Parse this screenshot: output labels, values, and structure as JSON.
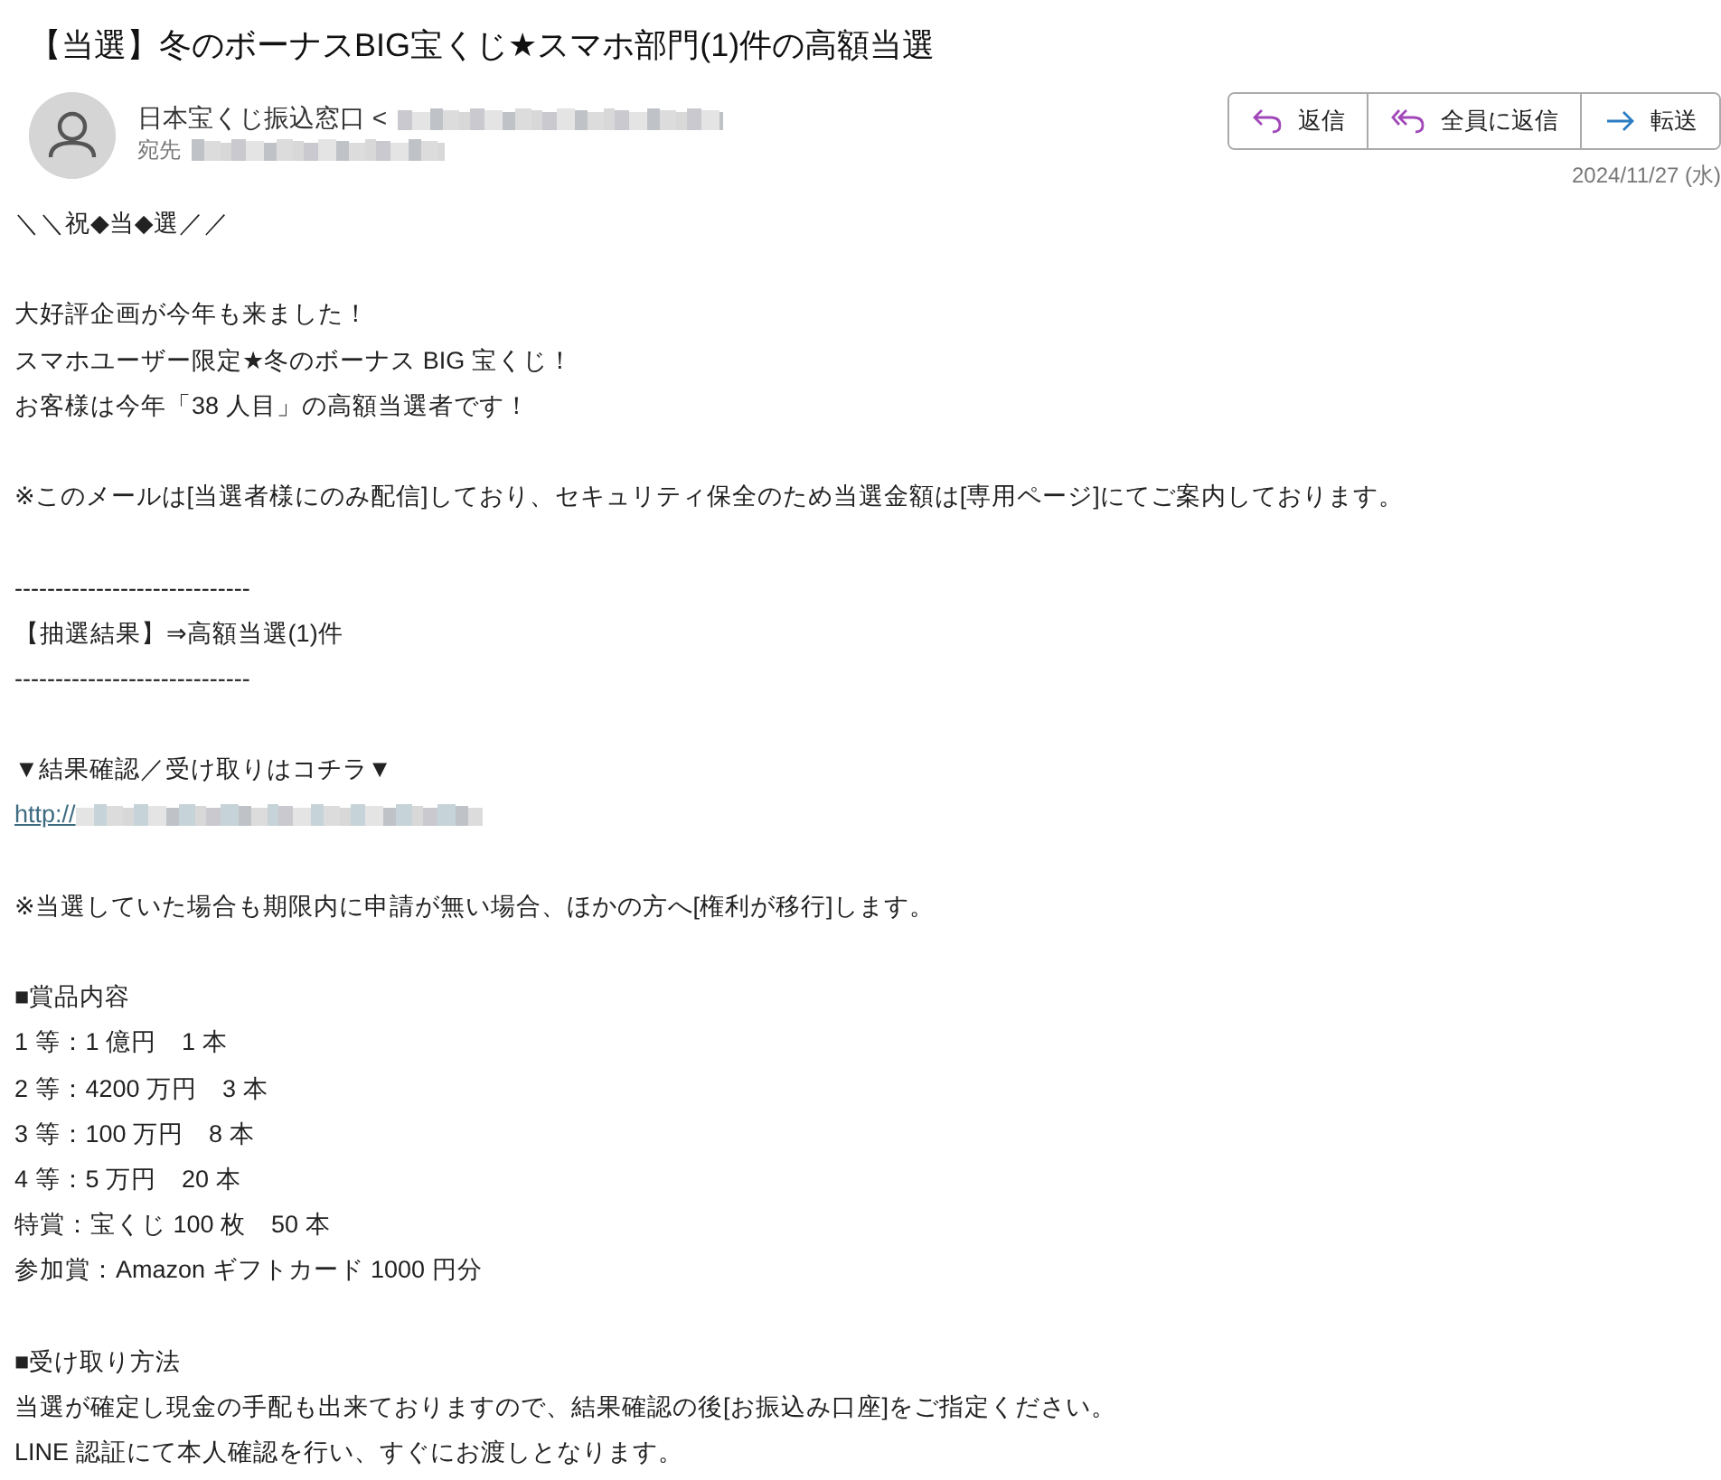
{
  "subject": "【当選】冬のボーナスBIG宝くじ★スマホ部門(1)件の高額当選",
  "sender": {
    "name": "日本宝くじ振込窓口",
    "bracket": "<",
    "address_redacted": true
  },
  "recipient": {
    "label": "宛先",
    "address_redacted": true
  },
  "actions": [
    {
      "kind": "reply",
      "label": "返信"
    },
    {
      "kind": "reply-all",
      "label": "全員に返信"
    },
    {
      "kind": "forward",
      "label": "転送"
    }
  ],
  "date": "2024/11/27 (水)",
  "body": [
    {
      "lines": [
        {
          "kind": "text",
          "text": "＼＼祝◆当◆選／／"
        }
      ]
    },
    {
      "lines": [
        {
          "kind": "text",
          "text": "大好評企画が今年も来ました！"
        },
        {
          "kind": "text",
          "text": "スマホユーザー限定★冬のボーナス BIG 宝くじ！"
        },
        {
          "kind": "text",
          "text": "お客様は今年「38 人目」の高額当選者です！"
        }
      ]
    },
    {
      "lines": [
        {
          "kind": "text",
          "text": "※このメールは[当選者様にのみ配信]しており、セキュリティ保全のため当選金額は[専用ページ]にてご案内しております。"
        }
      ]
    },
    {
      "lines": [
        {
          "kind": "text",
          "text": "-----------------------------"
        },
        {
          "kind": "text",
          "text": "【抽選結果】⇒高額当選(1)件"
        },
        {
          "kind": "text",
          "text": "-----------------------------"
        }
      ]
    },
    {
      "lines": [
        {
          "kind": "text",
          "text": "▼結果確認／受け取りはコチラ▼"
        },
        {
          "kind": "link",
          "text": "http://",
          "redacted": true
        }
      ]
    },
    {
      "lines": [
        {
          "kind": "text",
          "text": "※当選していた場合も期限内に申請が無い場合、ほかの方へ[権利が移行]します。"
        }
      ]
    },
    {
      "lines": [
        {
          "kind": "text",
          "text": "■賞品内容"
        },
        {
          "kind": "text",
          "text": "1 等：1 億円　1 本"
        },
        {
          "kind": "text",
          "text": "2 等：4200 万円　3 本"
        },
        {
          "kind": "text",
          "text": "3 等：100 万円　8 本"
        },
        {
          "kind": "text",
          "text": "4 等：5 万円　20 本"
        },
        {
          "kind": "text",
          "text": "特賞：宝くじ 100 枚　50 本"
        },
        {
          "kind": "text",
          "text": "参加賞：Amazon ギフトカード 1000 円分"
        }
      ]
    },
    {
      "lines": [
        {
          "kind": "text",
          "text": "■受け取り方法"
        },
        {
          "kind": "text",
          "text": "当選が確定し現金の手配も出来ておりますので、結果確認の後[お振込み口座]をご指定ください。"
        },
        {
          "kind": "text",
          "text": "LINE 認証にて本人確認を行い、すぐにお渡しとなります。"
        }
      ]
    }
  ]
}
